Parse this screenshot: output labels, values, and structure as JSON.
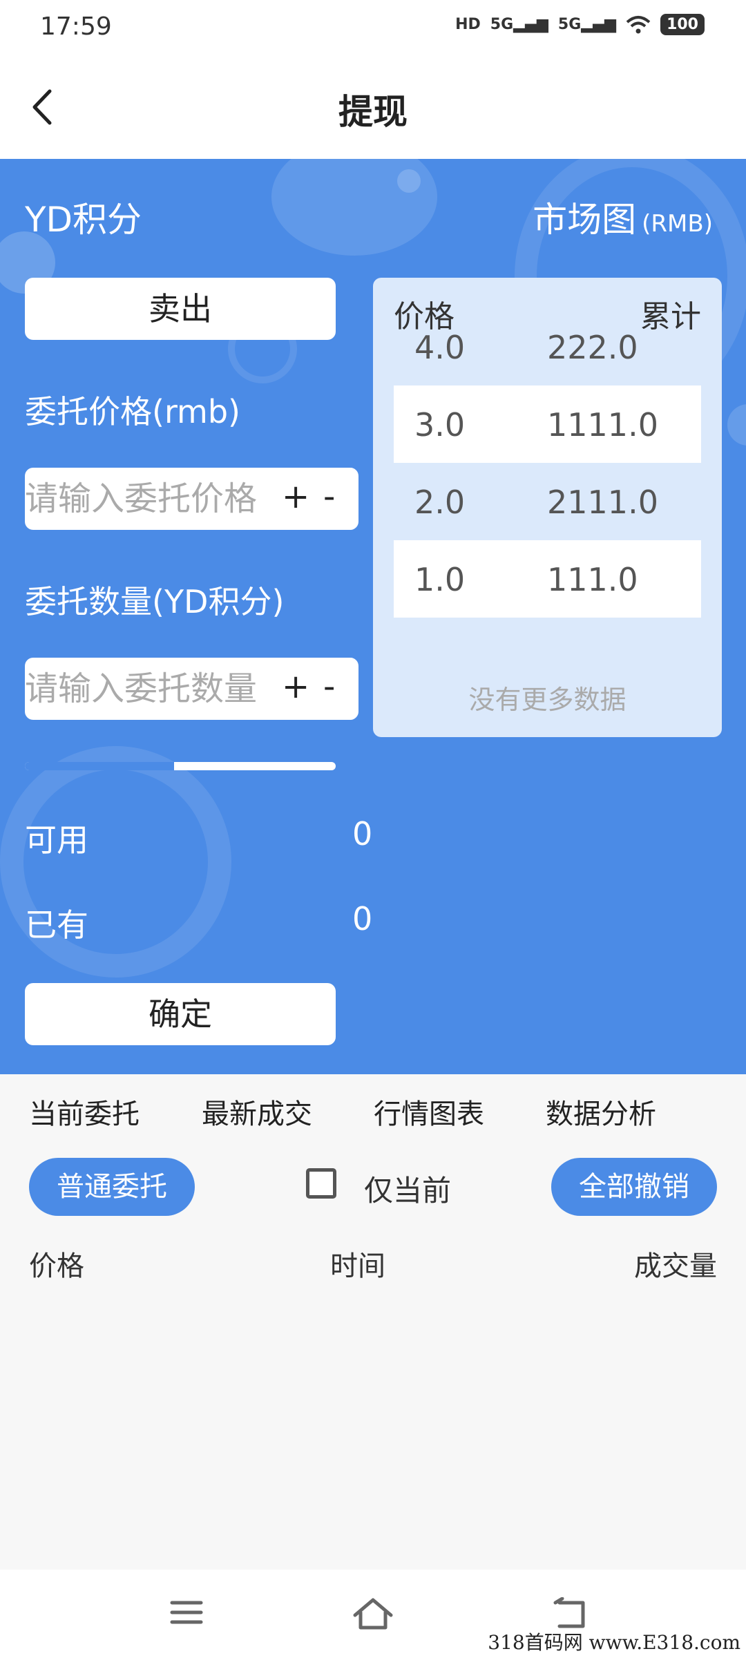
{
  "status_bar": {
    "time": "17:59",
    "hd": "HD",
    "sim1": "5G",
    "sim2": "5G",
    "battery": "100"
  },
  "nav": {
    "title": "提现"
  },
  "trade": {
    "asset_name": "YD积分",
    "market_title": "市场图",
    "market_unit": "(RMB)",
    "sell_label": "卖出",
    "price_label": "委托价格(rmb)",
    "price_placeholder": "请输入委托价格",
    "qty_label": "委托数量(YD积分)",
    "qty_placeholder": "请输入委托数量",
    "plus": "+",
    "minus": "-",
    "available_label": "可用",
    "available_value": "0",
    "owned_label": "已有",
    "owned_value": "0",
    "confirm_label": "确定",
    "progress_fraction": 0.48
  },
  "market": {
    "col_price": "价格",
    "col_total": "累计",
    "rows": [
      {
        "price": "4.0",
        "total": "222.0"
      },
      {
        "price": "3.0",
        "total": "1111.0"
      },
      {
        "price": "2.0",
        "total": "2111.0"
      },
      {
        "price": "1.0",
        "total": "111.0"
      }
    ],
    "empty_text": "没有更多数据"
  },
  "tabs": [
    "当前委托",
    "最新成交",
    "行情图表",
    "数据分析"
  ],
  "orders": {
    "normal_label": "普通委托",
    "only_current_label": "仅当前",
    "cancel_all_label": "全部撤销",
    "col_price": "价格",
    "col_time": "时间",
    "col_volume": "成交量"
  },
  "watermark": "318首码网 www.E318.com",
  "colors": {
    "primary": "#4b8be6",
    "card": "#dbe9fb"
  }
}
